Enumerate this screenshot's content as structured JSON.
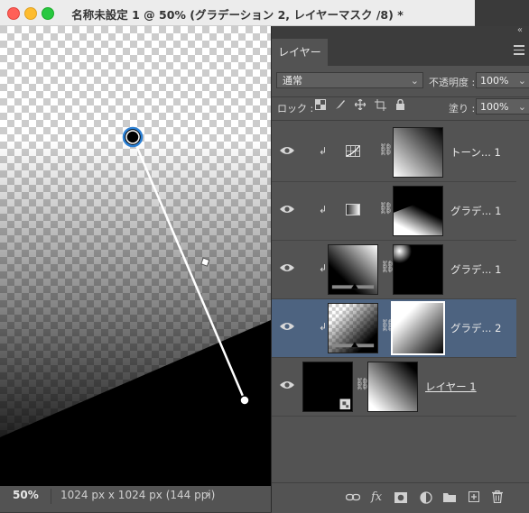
{
  "window": {
    "title": "名称未設定 1 @ 50% (グラデーション 2, レイヤーマスク /8) *"
  },
  "status": {
    "zoom": "50%",
    "doc_info": "1024 px x 1024 px (144 ppi)",
    "chevron": "›"
  },
  "panel": {
    "tab_label": "レイヤー",
    "collapse_glyph": "«",
    "blend_mode": "通常",
    "opacity_label": "不透明度 :",
    "opacity_value": "100%",
    "lock_label": "ロック :",
    "fill_label": "塗り :",
    "fill_value": "100%",
    "layers": [
      {
        "name": "トーン... 1",
        "type": "adjustment",
        "icon": "tone-curve-icon",
        "clipped": true,
        "selected": false
      },
      {
        "name": "グラデ... 1",
        "type": "adjustment",
        "icon": "gradient-map-icon",
        "clipped": true,
        "selected": false
      },
      {
        "name": "グラデ... 1",
        "type": "fill",
        "icon": "gradient-fill",
        "clipped": true,
        "selected": false
      },
      {
        "name": "グラデ... 2",
        "type": "fill",
        "icon": "gradient-fill",
        "clipped": true,
        "selected": true
      },
      {
        "name": "レイヤー 1",
        "type": "pixel",
        "icon": "smart-object-icon",
        "clipped": false,
        "selected": false
      }
    ],
    "bottom_icons": [
      "link-layers-icon",
      "fx-icon",
      "add-mask-icon",
      "adjustment-layer-icon",
      "new-group-icon",
      "new-layer-icon",
      "delete-icon"
    ],
    "fx_label": "fx"
  },
  "colors": {
    "panel_bg": "#535353",
    "selected_row": "#4d6380",
    "gradient_handle": "#2a7fd4"
  }
}
